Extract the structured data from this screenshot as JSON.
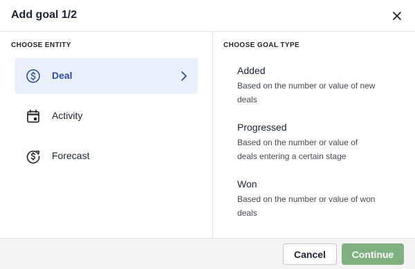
{
  "header": {
    "title": "Add goal 1/2",
    "close_icon": "close-icon"
  },
  "entity_panel": {
    "label": "CHOOSE ENTITY",
    "items": [
      {
        "label": "Deal",
        "icon": "dollar-circle-icon",
        "selected": true
      },
      {
        "label": "Activity",
        "icon": "calendar-icon",
        "selected": false
      },
      {
        "label": "Forecast",
        "icon": "forecast-dollar-icon",
        "selected": false
      }
    ]
  },
  "goal_type_panel": {
    "label": "CHOOSE GOAL TYPE",
    "items": [
      {
        "title": "Added",
        "description": "Based on the number or value of new deals"
      },
      {
        "title": "Progressed",
        "description": "Based on the number or value of deals entering a certain stage"
      },
      {
        "title": "Won",
        "description": "Based on the number or value of won deals"
      }
    ]
  },
  "footer": {
    "cancel_label": "Cancel",
    "continue_label": "Continue"
  },
  "colors": {
    "accent": "#2d4ea8",
    "selected_bg": "#e9f0fc",
    "continue_bg": "#7fb07f"
  }
}
